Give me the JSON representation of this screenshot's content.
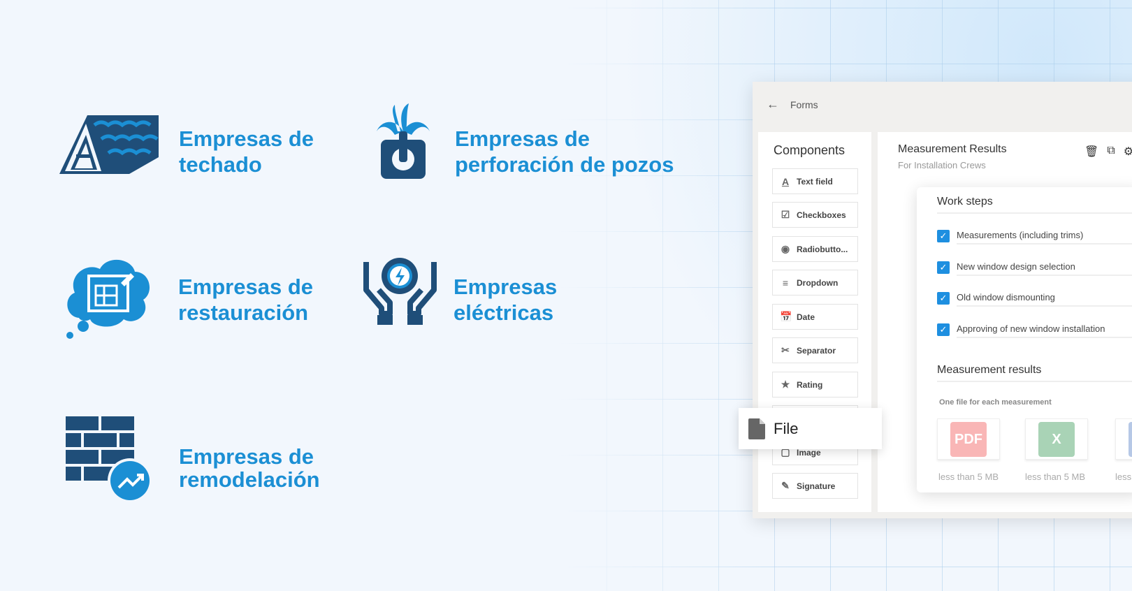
{
  "colors": {
    "accent": "#1b8fd4",
    "navy": "#1f4e79",
    "check": "#1e8fe0"
  },
  "features": [
    {
      "line1": "Empresas de",
      "line2": "techado",
      "icon": "roof-icon"
    },
    {
      "line1": "Empresas de",
      "line2": "perforación de pozos",
      "icon": "well-drilling-icon"
    },
    {
      "line1": "Empresas de",
      "line2": "restauración",
      "icon": "blueprint-cloud-icon"
    },
    {
      "line1": "Empresas",
      "line2": "eléctricas",
      "icon": "hands-gear-bolt-icon"
    },
    {
      "line1": "Empresas de",
      "line2": "remodelación",
      "icon": "brick-wall-growth-icon"
    }
  ],
  "app": {
    "back_label": "Forms",
    "components_title": "Components",
    "components": [
      {
        "label": "Text field",
        "icon": "text-field-icon"
      },
      {
        "label": "Checkboxes",
        "icon": "checkbox-icon"
      },
      {
        "label": "Radiobutto...",
        "icon": "radio-icon"
      },
      {
        "label": "Dropdown",
        "icon": "dropdown-icon"
      },
      {
        "label": "Date",
        "icon": "calendar-icon"
      },
      {
        "label": "Separator",
        "icon": "scissors-icon"
      },
      {
        "label": "Rating",
        "icon": "star-icon"
      },
      {
        "label": "",
        "icon": ""
      },
      {
        "label": "Image",
        "icon": "image-icon"
      },
      {
        "label": "Signature",
        "icon": "pencil-icon"
      }
    ],
    "drag_item": "File",
    "form_title": "Measurement Results",
    "form_subtitle": "For Installation Crews",
    "work_steps_title": "Work steps",
    "steps": [
      "Measurements (including trims)",
      "New window design selection",
      "Old window dismounting",
      "Approving of new window installation"
    ],
    "results_title": "Measurement results",
    "results_hint": "One file for each measurement",
    "files": [
      {
        "type": "PDF",
        "label": "less than 5 MB"
      },
      {
        "type": "X",
        "label": "less than 5 MB"
      },
      {
        "type": "",
        "label": "less"
      }
    ]
  }
}
